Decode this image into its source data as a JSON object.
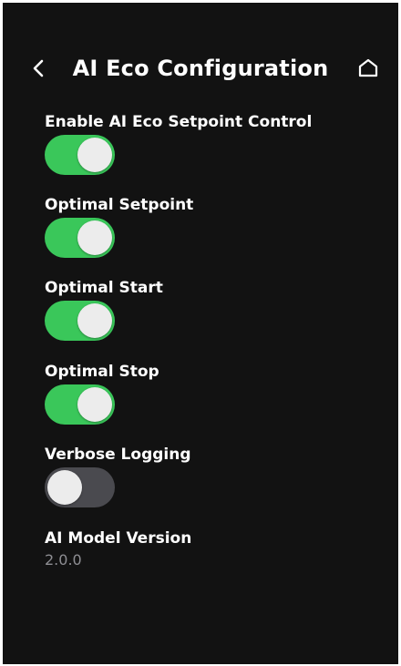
{
  "header": {
    "title": "AI Eco Configuration"
  },
  "settings": [
    {
      "label": "Enable AI Eco Setpoint Control",
      "enabled": true
    },
    {
      "label": "Optimal Setpoint",
      "enabled": true
    },
    {
      "label": "Optimal Start",
      "enabled": true
    },
    {
      "label": "Optimal Stop",
      "enabled": true
    },
    {
      "label": "Verbose Logging",
      "enabled": false
    }
  ],
  "model": {
    "label": "AI Model Version",
    "version": "2.0.0"
  },
  "colors": {
    "background": "#121212",
    "toggle_on": "#3ac75a",
    "toggle_off": "#4a4a4f",
    "knob": "#ececec",
    "text_primary": "#ffffff",
    "text_secondary": "#8e8e93"
  },
  "icons": {
    "back": "chevron-left-icon",
    "home": "home-icon"
  }
}
